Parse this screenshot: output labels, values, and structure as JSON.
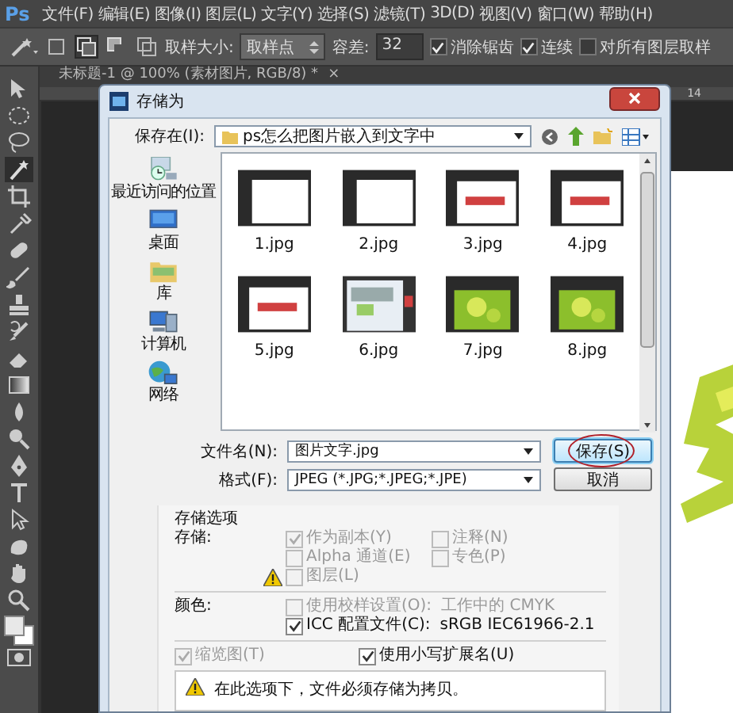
{
  "app_logo": "Ps",
  "menus": [
    "文件(F)",
    "编辑(E)",
    "图像(I)",
    "图层(L)",
    "文字(Y)",
    "选择(S)",
    "滤镜(T)",
    "3D(D)",
    "视图(V)",
    "窗口(W)",
    "帮助(H)"
  ],
  "options_bar": {
    "sample_size_label": "取样大小:",
    "sample_size_value": "取样点",
    "tolerance_label": "容差:",
    "tolerance_value": "32",
    "checkboxes": [
      {
        "label": "消除锯齿",
        "checked": true
      },
      {
        "label": "连续",
        "checked": true
      },
      {
        "label": "对所有图层取样",
        "checked": false
      }
    ]
  },
  "document_tab": {
    "title": "未标题-1 @ 100% (素材图片, RGB/8) *",
    "close_glyph": "×"
  },
  "ruler": {
    "top_label": "14"
  },
  "dialog": {
    "title": "存储为",
    "save_in_label": "保存在(I):",
    "folder": "ps怎么把图片嵌入到文字中",
    "places": [
      {
        "label": "最近访问的位置",
        "kind": "recent"
      },
      {
        "label": "桌面",
        "kind": "desktop"
      },
      {
        "label": "库",
        "kind": "library"
      },
      {
        "label": "计算机",
        "kind": "computer"
      },
      {
        "label": "网络",
        "kind": "network"
      }
    ],
    "files": [
      {
        "name": "1.jpg",
        "kind": "blank"
      },
      {
        "name": "2.jpg",
        "kind": "blank"
      },
      {
        "name": "3.jpg",
        "kind": "red"
      },
      {
        "name": "4.jpg",
        "kind": "red"
      },
      {
        "name": "5.jpg",
        "kind": "red"
      },
      {
        "name": "6.jpg",
        "kind": "screens"
      },
      {
        "name": "7.jpg",
        "kind": "green"
      },
      {
        "name": "8.jpg",
        "kind": "green"
      }
    ],
    "filename_label": "文件名(N):",
    "filename": "图片文字.jpg",
    "format_label": "格式(F):",
    "format": "JPEG (*.JPG;*.JPEG;*.JPE)",
    "buttons": [
      {
        "label": "保存(S)",
        "kind": "save",
        "annotated": true
      },
      {
        "label": "取消",
        "kind": "cancel",
        "annotated": false
      }
    ],
    "options": {
      "title": "存储选项",
      "save_label": "存储:",
      "save_checks": [
        {
          "label": "作为副本(Y)",
          "checked": true,
          "disabled": true,
          "warning": false
        },
        {
          "label": "注释(N)",
          "checked": false,
          "disabled": true,
          "warning": false
        },
        {
          "label": "Alpha 通道(E)",
          "checked": false,
          "disabled": true,
          "warning": false
        },
        {
          "label": "专色(P)",
          "checked": false,
          "disabled": true,
          "warning": false
        },
        {
          "label": "图层(L)",
          "checked": false,
          "disabled": true,
          "warning": true
        }
      ],
      "color_label": "颜色:",
      "color_checks": [
        {
          "label": "使用校样设置(O):",
          "value": "工作中的 CMYK",
          "checked": false,
          "disabled": true
        },
        {
          "label": "ICC 配置文件(C):",
          "value": "sRGB IEC61966-2.1",
          "checked": true,
          "disabled": false
        }
      ],
      "bottom_checks": [
        {
          "label": "缩览图(T)",
          "checked": true,
          "disabled": true
        },
        {
          "label": "使用小写扩展名(U)",
          "checked": true,
          "disabled": false
        }
      ],
      "warning": "在此选项下，文件必须存储为拷贝。"
    }
  }
}
